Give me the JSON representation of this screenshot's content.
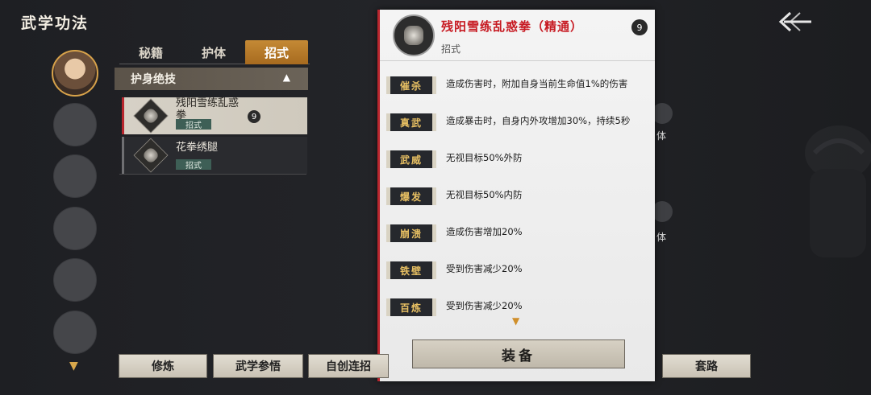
{
  "screen": {
    "title": "武学功法"
  },
  "tabs": [
    {
      "label": "秘籍",
      "active": false
    },
    {
      "label": "护体",
      "active": false
    },
    {
      "label": "招式",
      "active": true
    }
  ],
  "section": {
    "label": "护身绝技"
  },
  "skills": [
    {
      "name": "残阳雪练乱惑拳",
      "badge": "招式",
      "level": "9",
      "selected": true
    },
    {
      "name": "花拳绣腿",
      "badge": "招式",
      "selected": false
    }
  ],
  "detail": {
    "title": "残阳雪练乱惑拳（精通）",
    "subtitle": "招式",
    "level": "9",
    "traits": [
      {
        "label": "催杀",
        "desc": "造成伤害时，附加自身当前生命值1%的伤害"
      },
      {
        "label": "真武",
        "desc": "造成暴击时，自身内外攻增加30%，持续5秒"
      },
      {
        "label": "武威",
        "desc": "无视目标50%外防"
      },
      {
        "label": "爆发",
        "desc": "无视目标50%内防"
      },
      {
        "label": "崩溃",
        "desc": "造成伤害增加20%"
      },
      {
        "label": "铁壁",
        "desc": "受到伤害减少20%"
      },
      {
        "label": "百炼",
        "desc": "受到伤害减少20%"
      }
    ],
    "equip_label": "装备"
  },
  "bottom_buttons": [
    {
      "label": "修炼"
    },
    {
      "label": "武学参悟"
    },
    {
      "label": "自创连招"
    },
    {
      "label": "套路"
    }
  ],
  "background_labels": [
    "体",
    "体"
  ],
  "icons": {
    "back": "back-arrow-icon",
    "expand": "chevron-down-icon",
    "collapse": "chevron-up-icon"
  },
  "colors": {
    "accent_red": "#c71a22",
    "tab_gold": "#c58a35",
    "ring_gold": "#d7a24a"
  }
}
